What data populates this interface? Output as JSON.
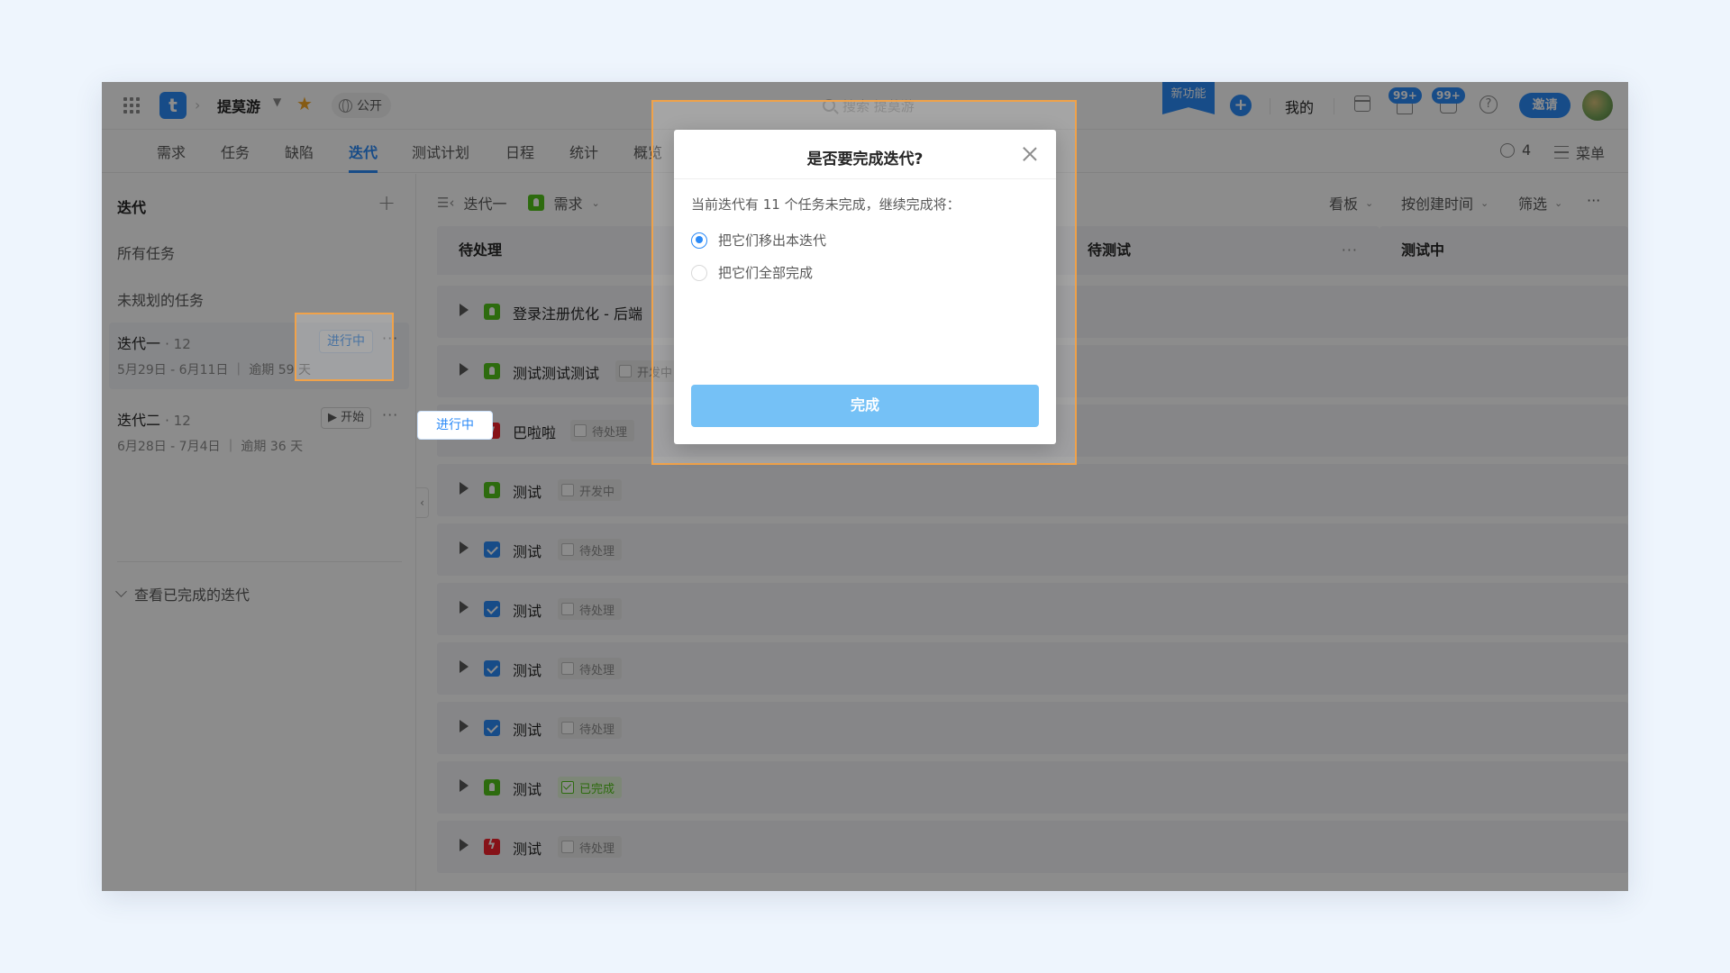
{
  "header": {
    "project_name": "提莫游",
    "public_label": "公开",
    "search_placeholder": "搜索 提莫游",
    "new_feature_label": "新功能",
    "mine_label": "我的",
    "notifications_count": "99+",
    "messages_count": "99+",
    "help_label": "?",
    "invite_label": "邀请",
    "logo_letter": "t"
  },
  "tabs": [
    {
      "label": "需求"
    },
    {
      "label": "任务"
    },
    {
      "label": "缺陷"
    },
    {
      "label": "迭代",
      "active": true
    },
    {
      "label": "测试计划"
    },
    {
      "label": "日程"
    },
    {
      "label": "统计"
    },
    {
      "label": "概览"
    }
  ],
  "tabbar_right": {
    "members_count": "4",
    "menu_label": "菜单"
  },
  "sidebar": {
    "title": "迭代",
    "all_tasks": "所有任务",
    "unplanned_tasks": "未规划的任务",
    "iterations": [
      {
        "name": "迭代一",
        "count": "· 12",
        "dates": "5月29日 - 6月11日 ｜ 逾期 59 天",
        "status": "进行中"
      },
      {
        "name": "迭代二",
        "count": "· 12",
        "dates": "6月28日 - 7月4日 ｜ 逾期 36 天",
        "action": "▶ 开始"
      }
    ],
    "view_completed": "查看已完成的迭代"
  },
  "toolbar": {
    "iteration_label": "迭代一",
    "type_label": "需求",
    "view_label": "看板",
    "sort_label": "按创建时间",
    "filter_label": "筛选"
  },
  "board": {
    "columns": [
      {
        "title": "待处理"
      },
      {
        "title": "待测试"
      },
      {
        "title": "测试中"
      }
    ],
    "rows": [
      {
        "type": "req",
        "title": "登录注册优化 - 后端",
        "status": ""
      },
      {
        "type": "req",
        "title": "测试测试测试",
        "status": "开发中"
      },
      {
        "type": "bug",
        "title": "巴啦啦",
        "status": "待处理"
      },
      {
        "type": "req",
        "title": "测试",
        "status": "开发中"
      },
      {
        "type": "task",
        "title": "测试",
        "status": "待处理"
      },
      {
        "type": "task",
        "title": "测试",
        "status": "待处理"
      },
      {
        "type": "task",
        "title": "测试",
        "status": "待处理"
      },
      {
        "type": "task",
        "title": "测试",
        "status": "待处理"
      },
      {
        "type": "req",
        "title": "测试",
        "status": "已完成",
        "done": true
      },
      {
        "type": "bug",
        "title": "测试",
        "status": "待处理"
      }
    ]
  },
  "modal": {
    "title": "是否要完成迭代?",
    "description": "当前迭代有 11 个任务未完成，继续完成将：",
    "options": [
      {
        "label": "把它们移出本迭代",
        "checked": true
      },
      {
        "label": "把它们全部完成",
        "checked": false
      }
    ],
    "confirm_label": "完成"
  },
  "colors": {
    "accent": "#2b8af7",
    "confirm_button": "#75c1f6",
    "highlight_border": "#f0a24a",
    "requirement": "#52c41a",
    "bug": "#f5222d"
  }
}
